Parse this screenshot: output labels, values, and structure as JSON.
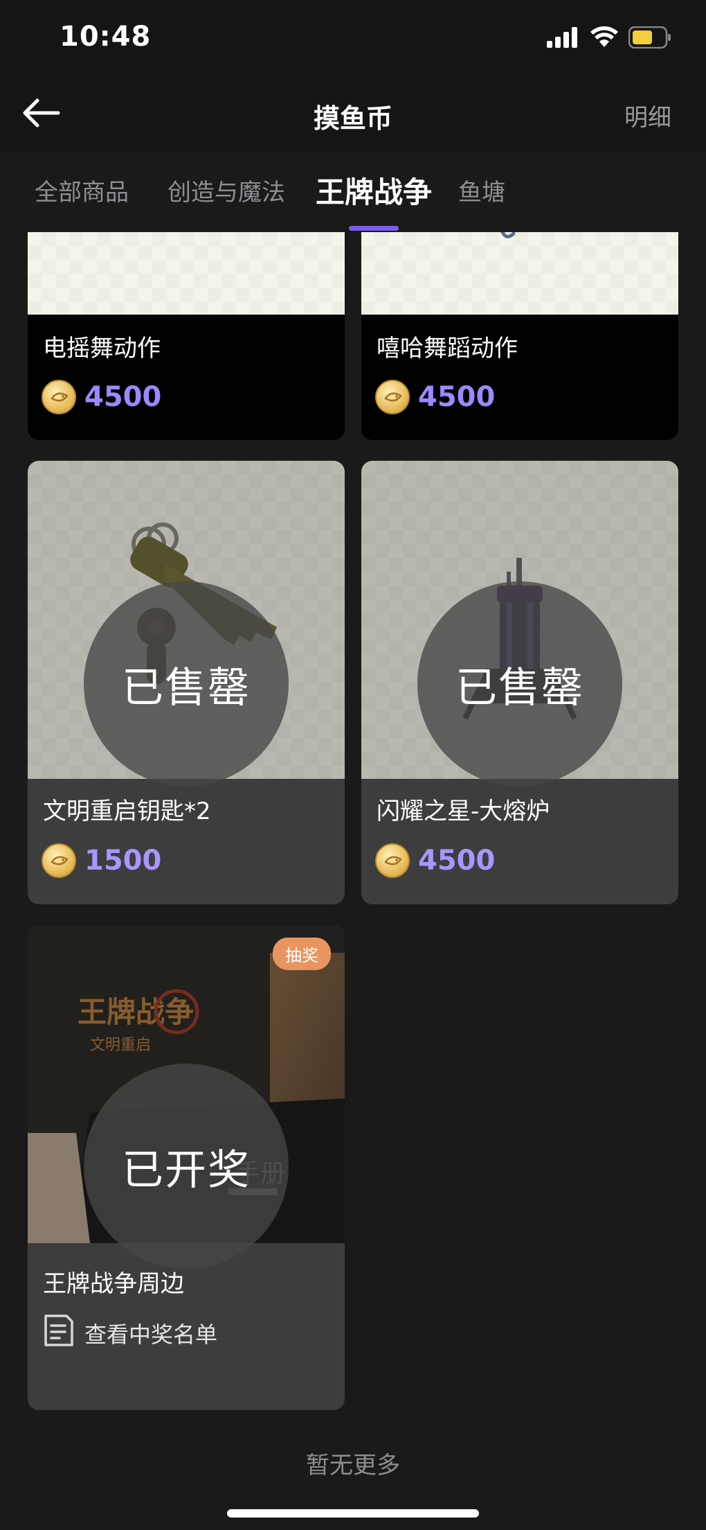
{
  "status": {
    "time": "10:48"
  },
  "nav": {
    "title": "摸鱼币",
    "detail": "明细"
  },
  "tabs": [
    {
      "label": "全部商品"
    },
    {
      "label": "创造与魔法"
    },
    {
      "label": "王牌战争"
    },
    {
      "label": "鱼塘"
    }
  ],
  "active_tab": "王牌战争",
  "products": [
    {
      "name": "电摇舞动作",
      "price": "4500"
    },
    {
      "name": "嘻哈舞蹈动作",
      "price": "4500"
    },
    {
      "name": "文明重启钥匙*2",
      "price": "1500",
      "overlay": "已售罄"
    },
    {
      "name": "闪耀之星-大熔炉",
      "price": "4500",
      "overlay": "已售罄"
    },
    {
      "name": "王牌战争周边",
      "badge": "抽奖",
      "overlay": "已开奖",
      "link": "查看中奖名单"
    }
  ],
  "product_image_text": {
    "logo_title": "王牌战争",
    "logo_sub": "文明重启",
    "book_text": "手册"
  },
  "footer": {
    "no_more": "暂无更多"
  },
  "colors": {
    "accent": "#7b5cf0",
    "price": "#9f88ff",
    "badge": "#e9955f"
  }
}
